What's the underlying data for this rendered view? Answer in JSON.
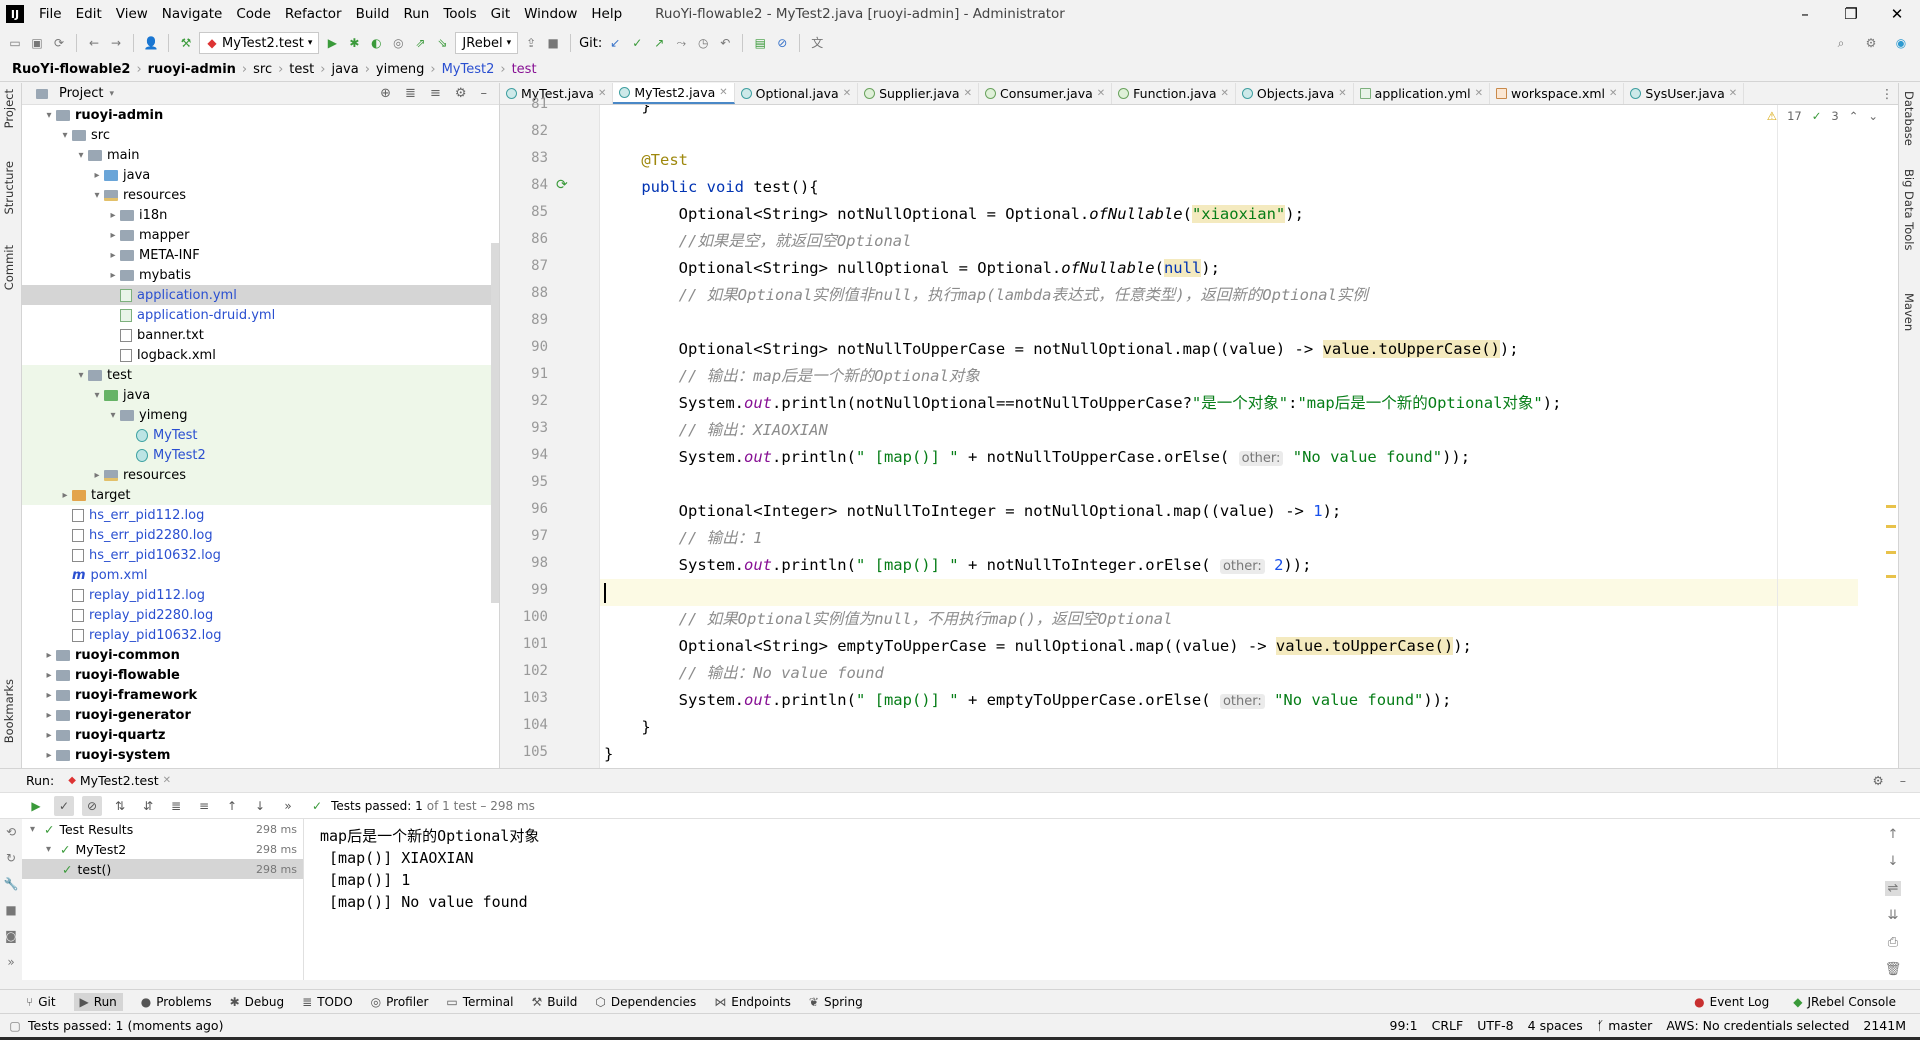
{
  "menubar": {
    "logo": "IJ",
    "items": [
      "File",
      "Edit",
      "View",
      "Navigate",
      "Code",
      "Refactor",
      "Build",
      "Run",
      "Tools",
      "Git",
      "Window",
      "Help"
    ],
    "window_title": "RuoYi-flowable2 - MyTest2.java [ruoyi-admin] - Administrator"
  },
  "toolbar": {
    "run_config": "MyTest2.test",
    "jrebel": "JRebel",
    "git_label": "Git:"
  },
  "breadcrumb": [
    "RuoYi-flowable2",
    "ruoyi-admin",
    "src",
    "test",
    "java",
    "yimeng",
    "MyTest2",
    "test"
  ],
  "left_strip": [
    "Project",
    "Structure",
    "Commit",
    "Bookmarks",
    "JRebel",
    "AWS Toolkit"
  ],
  "right_strip": [
    "Database",
    "Big Data Tools",
    "Maven"
  ],
  "project": {
    "header": "Project",
    "tree": [
      {
        "label": "ruoyi-admin",
        "indent": 1,
        "arrow": "▾",
        "kind": "module",
        "bold": true
      },
      {
        "label": "src",
        "indent": 2,
        "arrow": "▾",
        "kind": "folder"
      },
      {
        "label": "main",
        "indent": 3,
        "arrow": "▾",
        "kind": "folder"
      },
      {
        "label": "java",
        "indent": 4,
        "arrow": "▸",
        "kind": "blue"
      },
      {
        "label": "resources",
        "indent": 4,
        "arrow": "▾",
        "kind": "res"
      },
      {
        "label": "i18n",
        "indent": 5,
        "arrow": "▸",
        "kind": "folder"
      },
      {
        "label": "mapper",
        "indent": 5,
        "arrow": "▸",
        "kind": "folder"
      },
      {
        "label": "META-INF",
        "indent": 5,
        "arrow": "▸",
        "kind": "folder"
      },
      {
        "label": "mybatis",
        "indent": 5,
        "arrow": "▸",
        "kind": "folder"
      },
      {
        "label": "application.yml",
        "indent": 5,
        "arrow": "",
        "kind": "yml",
        "link": true,
        "selected": true
      },
      {
        "label": "application-druid.yml",
        "indent": 5,
        "arrow": "",
        "kind": "yml",
        "link": true
      },
      {
        "label": "banner.txt",
        "indent": 5,
        "arrow": "",
        "kind": "file"
      },
      {
        "label": "logback.xml",
        "indent": 5,
        "arrow": "",
        "kind": "file"
      },
      {
        "label": "test",
        "indent": 3,
        "arrow": "▾",
        "kind": "folder",
        "test": true
      },
      {
        "label": "java",
        "indent": 4,
        "arrow": "▾",
        "kind": "green",
        "test": true
      },
      {
        "label": "yimeng",
        "indent": 5,
        "arrow": "▾",
        "kind": "folder",
        "test": true
      },
      {
        "label": "MyTest",
        "indent": 6,
        "arrow": "",
        "kind": "cls",
        "link": true,
        "test": true
      },
      {
        "label": "MyTest2",
        "indent": 6,
        "arrow": "",
        "kind": "cls",
        "link": true,
        "test": true
      },
      {
        "label": "resources",
        "indent": 4,
        "arrow": "▸",
        "kind": "res",
        "test": true
      },
      {
        "label": "target",
        "indent": 2,
        "arrow": "▸",
        "kind": "orange",
        "test": true
      },
      {
        "label": "hs_err_pid112.log",
        "indent": 2,
        "arrow": "",
        "kind": "file",
        "link": true
      },
      {
        "label": "hs_err_pid2280.log",
        "indent": 2,
        "arrow": "",
        "kind": "file",
        "link": true
      },
      {
        "label": "hs_err_pid10632.log",
        "indent": 2,
        "arrow": "",
        "kind": "file",
        "link": true
      },
      {
        "label": "pom.xml",
        "indent": 2,
        "arrow": "",
        "kind": "maven",
        "link": true
      },
      {
        "label": "replay_pid112.log",
        "indent": 2,
        "arrow": "",
        "kind": "file",
        "link": true
      },
      {
        "label": "replay_pid2280.log",
        "indent": 2,
        "arrow": "",
        "kind": "file",
        "link": true
      },
      {
        "label": "replay_pid10632.log",
        "indent": 2,
        "arrow": "",
        "kind": "file",
        "link": true
      },
      {
        "label": "ruoyi-common",
        "indent": 1,
        "arrow": "▸",
        "kind": "module",
        "bold": true
      },
      {
        "label": "ruoyi-flowable",
        "indent": 1,
        "arrow": "▸",
        "kind": "module",
        "bold": true
      },
      {
        "label": "ruoyi-framework",
        "indent": 1,
        "arrow": "▸",
        "kind": "module",
        "bold": true
      },
      {
        "label": "ruoyi-generator",
        "indent": 1,
        "arrow": "▸",
        "kind": "module",
        "bold": true
      },
      {
        "label": "ruoyi-quartz",
        "indent": 1,
        "arrow": "▸",
        "kind": "module",
        "bold": true
      },
      {
        "label": "ruoyi-system",
        "indent": 1,
        "arrow": "▸",
        "kind": "module",
        "bold": true
      }
    ]
  },
  "editor": {
    "tabs": [
      {
        "label": "MyTest.java",
        "icon": "class"
      },
      {
        "label": "MyTest2.java",
        "icon": "class",
        "active": true
      },
      {
        "label": "Optional.java",
        "icon": "class"
      },
      {
        "label": "Supplier.java",
        "icon": "iface"
      },
      {
        "label": "Consumer.java",
        "icon": "iface"
      },
      {
        "label": "Function.java",
        "icon": "iface"
      },
      {
        "label": "Objects.java",
        "icon": "class"
      },
      {
        "label": "application.yml",
        "icon": "yml"
      },
      {
        "label": "workspace.xml",
        "icon": "xml"
      },
      {
        "label": "SysUser.java",
        "icon": "class"
      }
    ],
    "warnings": "17",
    "checks": "3",
    "lines": [
      "81",
      "82",
      "83",
      "84",
      "85",
      "86",
      "87",
      "88",
      "89",
      "90",
      "91",
      "92",
      "93",
      "94",
      "95",
      "96",
      "97",
      "98",
      "99",
      "100",
      "101",
      "102",
      "103",
      "104",
      "105"
    ],
    "code": [
      [
        {
          "t": "    }",
          "c": ""
        }
      ],
      [
        {
          "t": "",
          "c": ""
        }
      ],
      [
        {
          "t": "    @Test",
          "c": "ann"
        }
      ],
      [
        {
          "t": "    ",
          "c": ""
        },
        {
          "t": "public void ",
          "c": "kw"
        },
        {
          "t": "test(){",
          "c": ""
        }
      ],
      [
        {
          "t": "        Optional<String> notNullOptional = Optional.",
          "c": ""
        },
        {
          "t": "ofNullable",
          "c": "mi"
        },
        {
          "t": "(",
          "c": ""
        },
        {
          "t": "\"xiaoxian\"",
          "c": "str hl"
        },
        {
          "t": ");",
          "c": ""
        }
      ],
      [
        {
          "t": "        //如果是空，就返回空Optional",
          "c": "cmt"
        }
      ],
      [
        {
          "t": "        Optional<String> nullOptional = Optional.",
          "c": ""
        },
        {
          "t": "ofNullable",
          "c": "mi"
        },
        {
          "t": "(",
          "c": ""
        },
        {
          "t": "null",
          "c": "kw hl"
        },
        {
          "t": ");",
          "c": ""
        }
      ],
      [
        {
          "t": "        // 如果Optional实例值非null，执行map(lambda表达式，任意类型)，返回新的Optional实例",
          "c": "cmt"
        }
      ],
      [
        {
          "t": "",
          "c": ""
        }
      ],
      [
        {
          "t": "        Optional<String> notNullToUpperCase = notNullOptional.map((value) -> ",
          "c": ""
        },
        {
          "t": "value.toUpperCase()",
          "c": "hl"
        },
        {
          "t": ");",
          "c": ""
        }
      ],
      [
        {
          "t": "        // 输出：map后是一个新的Optional对象",
          "c": "cmt"
        }
      ],
      [
        {
          "t": "        System.",
          "c": ""
        },
        {
          "t": "out",
          "c": "st"
        },
        {
          "t": ".println(notNullOptional==notNullToUpperCase?",
          "c": ""
        },
        {
          "t": "\"是一个对象\"",
          "c": "str"
        },
        {
          "t": ":",
          "c": ""
        },
        {
          "t": "\"map后是一个新的Optional对象\"",
          "c": "str"
        },
        {
          "t": ");",
          "c": ""
        }
      ],
      [
        {
          "t": "        // 输出：XIAOXIAN",
          "c": "cmt"
        }
      ],
      [
        {
          "t": "        System.",
          "c": ""
        },
        {
          "t": "out",
          "c": "st"
        },
        {
          "t": ".println(",
          "c": ""
        },
        {
          "t": "\" [map()] \"",
          "c": "str"
        },
        {
          "t": " + notNullToUpperCase.orElse( ",
          "c": ""
        },
        {
          "t": "other:",
          "c": "hint"
        },
        {
          "t": " ",
          "c": ""
        },
        {
          "t": "\"No value found\"",
          "c": "str"
        },
        {
          "t": "));",
          "c": ""
        }
      ],
      [
        {
          "t": "",
          "c": ""
        }
      ],
      [
        {
          "t": "        Optional<Integer> notNullToInteger = notNullOptional.map((value) -> ",
          "c": ""
        },
        {
          "t": "1",
          "c": "num"
        },
        {
          "t": ");",
          "c": ""
        }
      ],
      [
        {
          "t": "        // 输出：1",
          "c": "cmt"
        }
      ],
      [
        {
          "t": "        System.",
          "c": ""
        },
        {
          "t": "out",
          "c": "st"
        },
        {
          "t": ".println(",
          "c": ""
        },
        {
          "t": "\" [map()] \"",
          "c": "str"
        },
        {
          "t": " + notNullToInteger.orElse( ",
          "c": ""
        },
        {
          "t": "other:",
          "c": "hint"
        },
        {
          "t": " ",
          "c": ""
        },
        {
          "t": "2",
          "c": "num"
        },
        {
          "t": "));",
          "c": ""
        }
      ],
      [
        {
          "t": "",
          "c": ""
        }
      ],
      [
        {
          "t": "        // 如果Optional实例值为null，不用执行map()，返回空Optional",
          "c": "cmt"
        }
      ],
      [
        {
          "t": "        Optional<String> emptyToUpperCase = nullOptional.map((value) -> ",
          "c": ""
        },
        {
          "t": "value.toUpperCase()",
          "c": "hl"
        },
        {
          "t": ");",
          "c": ""
        }
      ],
      [
        {
          "t": "        // 输出：No value found",
          "c": "cmt"
        }
      ],
      [
        {
          "t": "        System.",
          "c": ""
        },
        {
          "t": "out",
          "c": "st"
        },
        {
          "t": ".println(",
          "c": ""
        },
        {
          "t": "\" [map()] \"",
          "c": "str"
        },
        {
          "t": " + emptyToUpperCase.orElse( ",
          "c": ""
        },
        {
          "t": "other:",
          "c": "hint"
        },
        {
          "t": " ",
          "c": ""
        },
        {
          "t": "\"No value found\"",
          "c": "str"
        },
        {
          "t": "));",
          "c": ""
        }
      ],
      [
        {
          "t": "    }",
          "c": ""
        }
      ],
      [
        {
          "t": "}",
          "c": ""
        }
      ]
    ]
  },
  "run": {
    "label": "Run:",
    "tab": "MyTest2.test",
    "status_pass": "Tests passed: 1",
    "status_rest": "of 1 test – 298 ms",
    "tests": [
      {
        "label": "Test Results",
        "time": "298 ms",
        "indent": 1
      },
      {
        "label": "MyTest2",
        "time": "298 ms",
        "indent": 2
      },
      {
        "label": "test()",
        "time": "298 ms",
        "indent": 3,
        "selected": true
      }
    ],
    "console": [
      "map后是一个新的Optional对象",
      " [map()] XIAOXIAN",
      " [map()] 1",
      " [map()] No value found"
    ]
  },
  "toolwindows": {
    "left": [
      "Git",
      "Run",
      "Problems",
      "Debug",
      "TODO",
      "Profiler",
      "Terminal",
      "Build",
      "Dependencies",
      "Endpoints",
      "Spring"
    ],
    "right": [
      "Event Log",
      "JRebel Console"
    ]
  },
  "statusbar": {
    "message": "Tests passed: 1 (moments ago)",
    "position": "99:1",
    "line_sep": "CRLF",
    "encoding": "UTF-8",
    "indent": "4 spaces",
    "branch": "master",
    "aws": "AWS: No credentials selected",
    "memory": "2141M"
  }
}
